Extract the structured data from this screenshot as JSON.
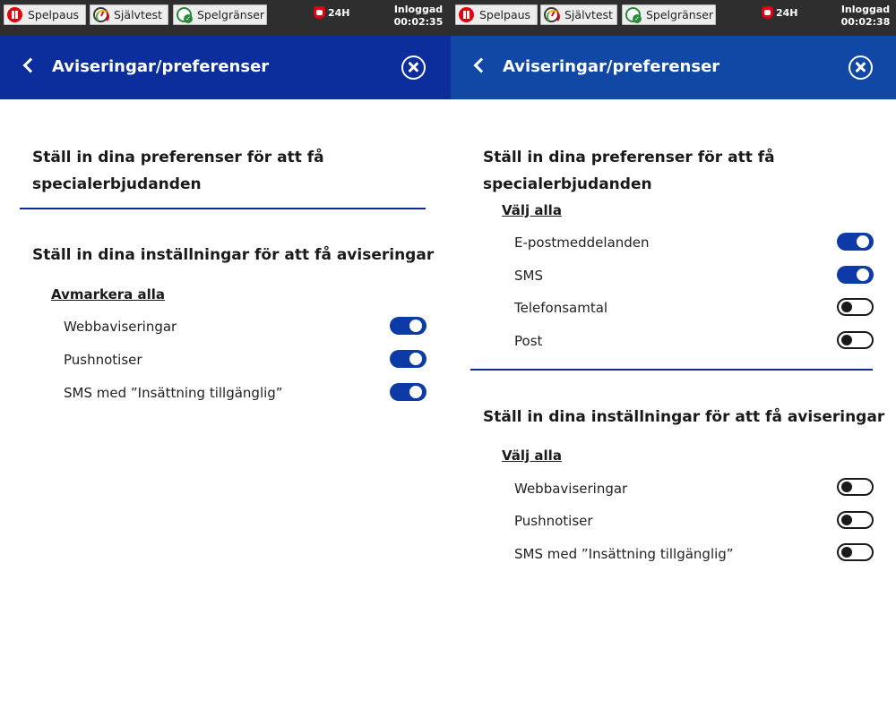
{
  "left": {
    "topbar": {
      "spelpaus": "Spelpaus",
      "sjalvtest": "Självtest",
      "spelgranser": "Spelgränser",
      "badge": "24H",
      "status": "Inloggad",
      "timer": "00:02:35"
    },
    "header": {
      "title": "Aviseringar/preferenser"
    },
    "offers_heading": "Ställ in dina preferenser för att få specialerbjudanden",
    "notif_heading": "Ställ in dina inställningar för att få aviseringar",
    "notif_link": "Avmarkera alla",
    "notif_items": [
      {
        "label": "Webbaviseringar",
        "on": true
      },
      {
        "label": "Pushnotiser",
        "on": true
      },
      {
        "label": "SMS med ”Insättning tillgänglig”",
        "on": true
      }
    ]
  },
  "right": {
    "topbar": {
      "spelpaus": "Spelpaus",
      "sjalvtest": "Självtest",
      "spelgranser": "Spelgränser",
      "badge": "24H",
      "status": "Inloggad",
      "timer": "00:02:38"
    },
    "header": {
      "title": "Aviseringar/preferenser"
    },
    "offers_heading": "Ställ in dina preferenser för att få specialerbjudanden",
    "offers_link": "Välj alla",
    "offers_items": [
      {
        "label": "E-postmeddelanden",
        "on": true
      },
      {
        "label": "SMS",
        "on": true
      },
      {
        "label": "Telefonsamtal",
        "on": false
      },
      {
        "label": "Post",
        "on": false
      }
    ],
    "notif_heading": "Ställ in dina inställningar för att få aviseringar",
    "notif_link": "Välj alla",
    "notif_items": [
      {
        "label": "Webbaviseringar",
        "on": false
      },
      {
        "label": "Pushnotiser",
        "on": false
      },
      {
        "label": "SMS med ”Insättning tillgänglig”",
        "on": false
      }
    ]
  },
  "colors": {
    "header_left": "#0c2d9c",
    "header_right": "#1148a6",
    "toggle_on": "#0c3aa6",
    "topbar": "#2e2e2e",
    "spelpaus_red": "#e3000f"
  }
}
